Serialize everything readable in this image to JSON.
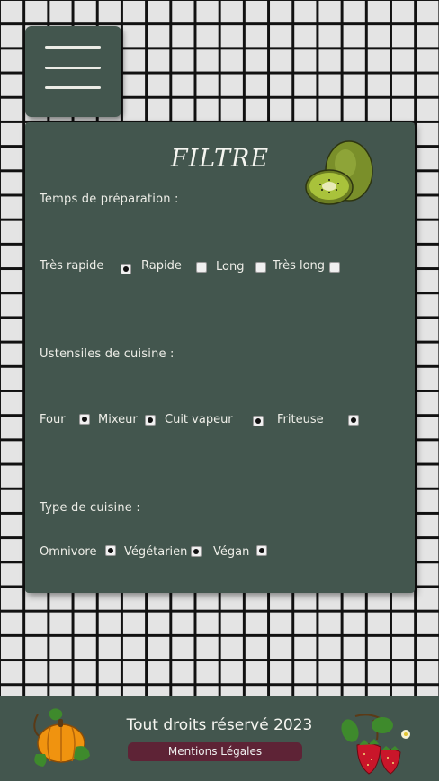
{
  "filter": {
    "title": "FILTRE",
    "sections": {
      "time": {
        "label": "Temps de préparation :",
        "options": [
          {
            "label": "Très rapide",
            "checked": true
          },
          {
            "label": "Rapide",
            "checked": false
          },
          {
            "label": "Long",
            "checked": false
          },
          {
            "label": "Très long",
            "checked": false
          }
        ]
      },
      "tools": {
        "label": "Ustensiles de cuisine :",
        "options": [
          {
            "label": "Four",
            "checked": true
          },
          {
            "label": "Mixeur",
            "checked": true
          },
          {
            "label": "Cuit vapeur",
            "checked": true
          },
          {
            "label": "Friteuse",
            "checked": true
          }
        ]
      },
      "cuisine": {
        "label": "Type de cuisine :",
        "options": [
          {
            "label": "Omnivore",
            "checked": true
          },
          {
            "label": "Végétarien",
            "checked": true
          },
          {
            "label": "Végan",
            "checked": true
          }
        ]
      }
    }
  },
  "footer": {
    "copyright": "Tout droits réservé 2023",
    "legal_link": "Mentions Légales"
  },
  "icons": [
    "menu-icon",
    "kiwi-icon",
    "pumpkin-icon",
    "strawberry-icon"
  ]
}
